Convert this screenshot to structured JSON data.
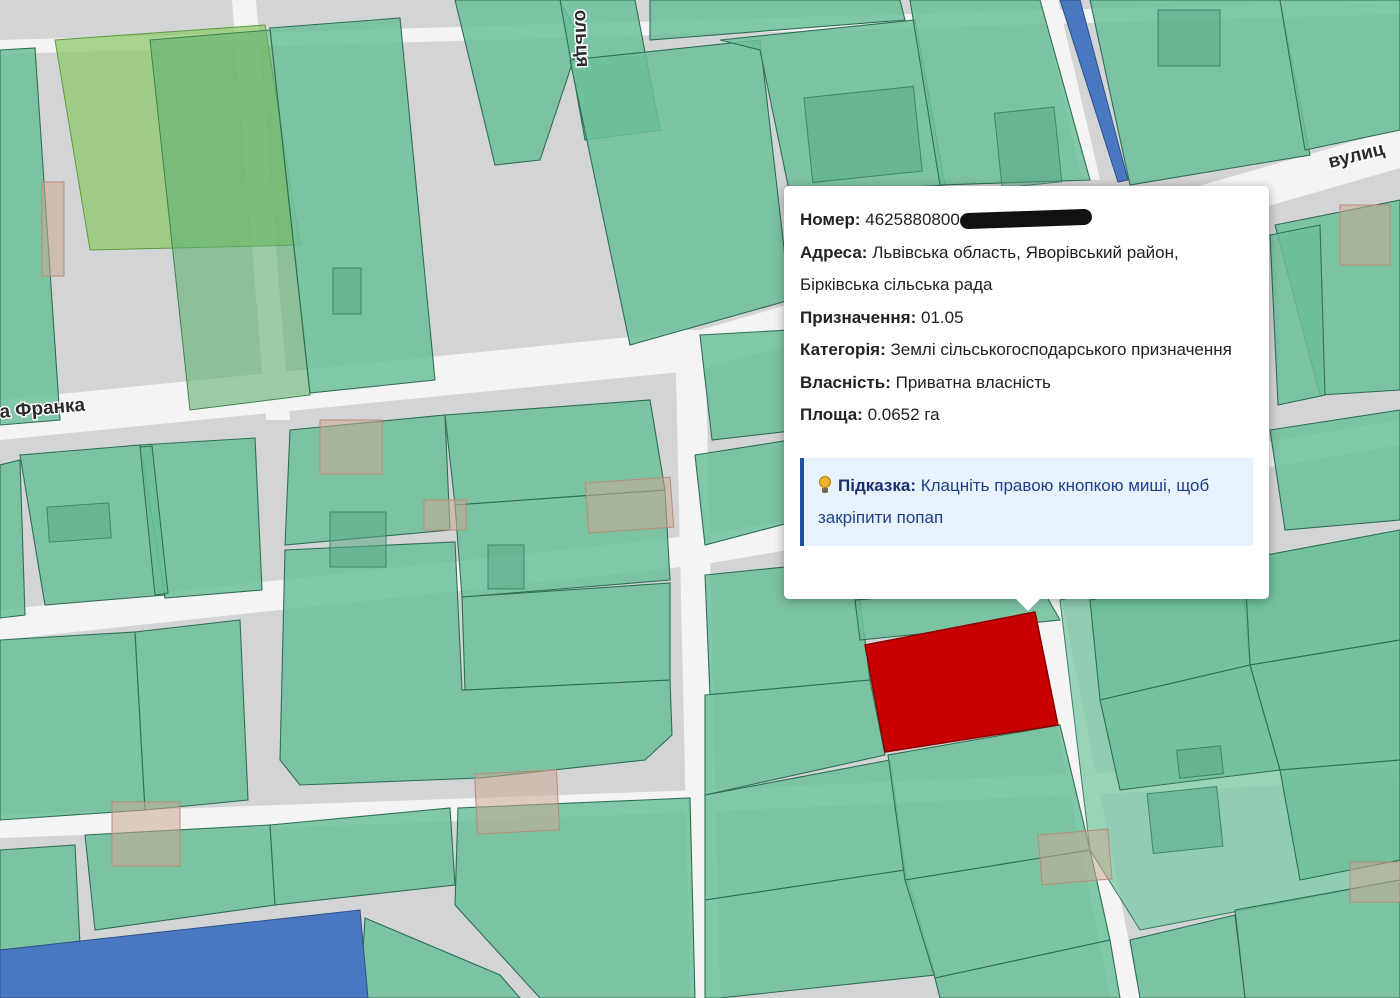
{
  "map": {
    "streets": [
      {
        "label": "а Франка"
      },
      {
        "label": "вулиц"
      },
      {
        "label": "ольця"
      }
    ],
    "colors": {
      "parcel": "#6cc09a",
      "selected_parcel": "#c80000",
      "agri_parcel": "#8fc96b",
      "water": "#4a78c0"
    }
  },
  "popup": {
    "number_label": "Номер:",
    "number_value": "4625880800",
    "address_label": "Адреса:",
    "address_value": "Львівська область, Яворівський район, Бірківська сільська рада",
    "purpose_label": "Призначення:",
    "purpose_value": "01.05",
    "category_label": "Категорія:",
    "category_value": "Землі сільськогосподарського призначення",
    "ownership_label": "Власність:",
    "ownership_value": "Приватна власність",
    "area_label": "Площа:",
    "area_value": "0.0652 га",
    "hint_label": "Підказка:",
    "hint_text": "Клацніть правою кнопкою миші, щоб закріпити попап"
  }
}
